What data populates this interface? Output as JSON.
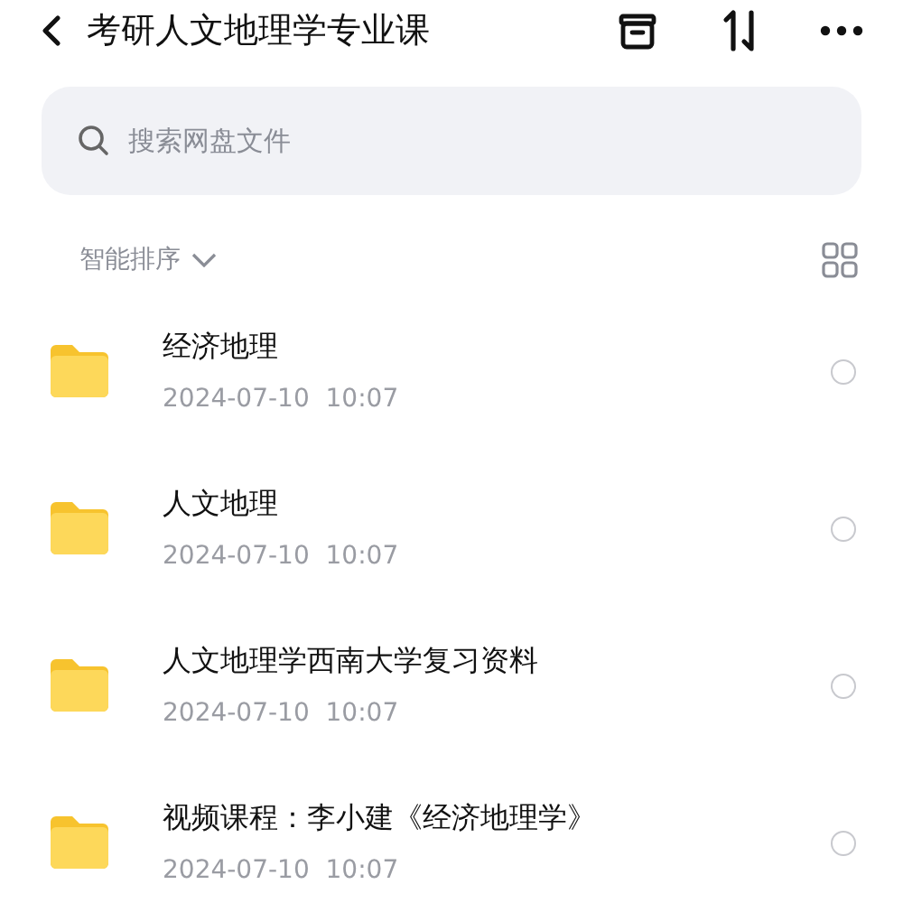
{
  "header": {
    "title": "考研人文地理学专业课"
  },
  "search": {
    "placeholder": "搜索网盘文件"
  },
  "sort": {
    "label": "智能排序"
  },
  "files": [
    {
      "name": "经济地理",
      "date": "2024-07-10  10:07",
      "selected": false
    },
    {
      "name": "人文地理",
      "date": "2024-07-10  10:07",
      "selected": false
    },
    {
      "name": "人文地理学西南大学复习资料",
      "date": "2024-07-10  10:07",
      "selected": false
    },
    {
      "name": "视频课程：李小建《经济地理学》",
      "date": "2024-07-10  10:07",
      "selected": false
    }
  ]
}
